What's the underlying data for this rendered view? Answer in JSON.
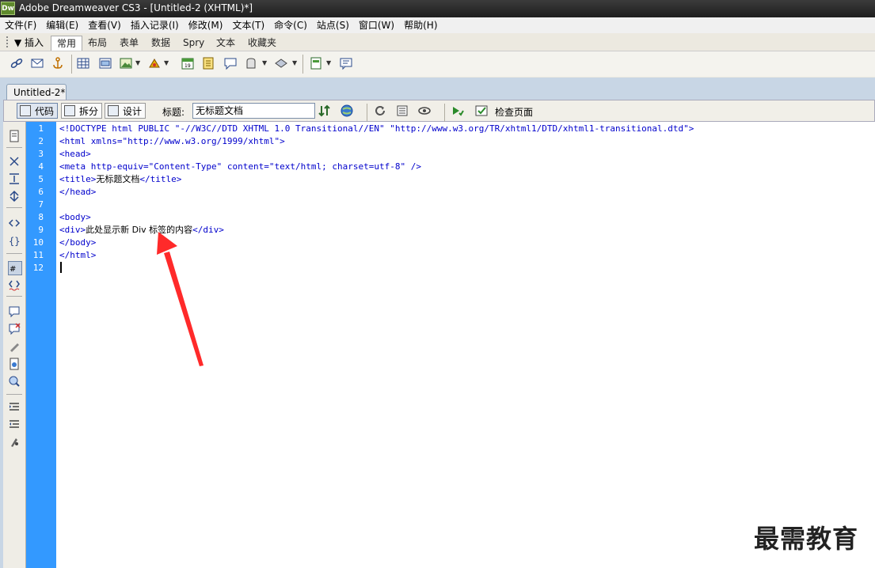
{
  "window": {
    "app_logo": "Dw",
    "title": "Adobe Dreamweaver CS3 - [Untitled-2 (XHTML)*]"
  },
  "menu": [
    "文件(F)",
    "编辑(E)",
    "查看(V)",
    "插入记录(I)",
    "修改(M)",
    "文本(T)",
    "命令(C)",
    "站点(S)",
    "窗口(W)",
    "帮助(H)"
  ],
  "insert_bar": {
    "title": "▼ 插入",
    "tabs": [
      {
        "label": "常用",
        "active": true
      },
      {
        "label": "布局"
      },
      {
        "label": "表单"
      },
      {
        "label": "数据"
      },
      {
        "label": "Spry"
      },
      {
        "label": "文本"
      },
      {
        "label": "收藏夹"
      }
    ]
  },
  "document": {
    "tab_label": "Untitled-2*",
    "view_buttons": [
      {
        "label": "代码",
        "active": true
      },
      {
        "label": "拆分"
      },
      {
        "label": "设计"
      }
    ],
    "title_label": "标题:",
    "title_value": "无标题文档",
    "check_page_label": "检查页面"
  },
  "code": {
    "line_numbers": [
      "1",
      "2",
      "3",
      "4",
      "5",
      "6",
      "7",
      "8",
      "9",
      "10",
      "11",
      "12"
    ],
    "lines": [
      {
        "pre": "<!DOCTYPE html PUBLIC \"-//W3C//DTD XHTML 1.0 Transitional//EN\" \"http://www.w3.org/TR/xhtml1/DTD/xhtml1-transitional.dtd\">",
        "txt": "",
        "post": ""
      },
      {
        "pre": "<html xmlns=\"http://www.w3.org/1999/xhtml\">",
        "txt": "",
        "post": ""
      },
      {
        "pre": "<head>",
        "txt": "",
        "post": ""
      },
      {
        "pre": "<meta http-equiv=\"Content-Type\" content=\"text/html; charset=utf-8\" />",
        "txt": "",
        "post": ""
      },
      {
        "pre": "<title>",
        "txt": "无标题文档",
        "post": "</title>"
      },
      {
        "pre": "</head>",
        "txt": "",
        "post": ""
      },
      {
        "pre": "",
        "txt": "",
        "post": ""
      },
      {
        "pre": "<body>",
        "txt": "",
        "post": ""
      },
      {
        "pre": "<div>",
        "txt": "此处显示新 Div 标签的内容",
        "post": "</div>"
      },
      {
        "pre": "</body>",
        "txt": "",
        "post": ""
      },
      {
        "pre": "</html>",
        "txt": "",
        "post": ""
      },
      {
        "pre": "",
        "txt": "",
        "post": ""
      }
    ]
  },
  "annotation_color": "#ff2a2a",
  "watermark": "最需教育"
}
